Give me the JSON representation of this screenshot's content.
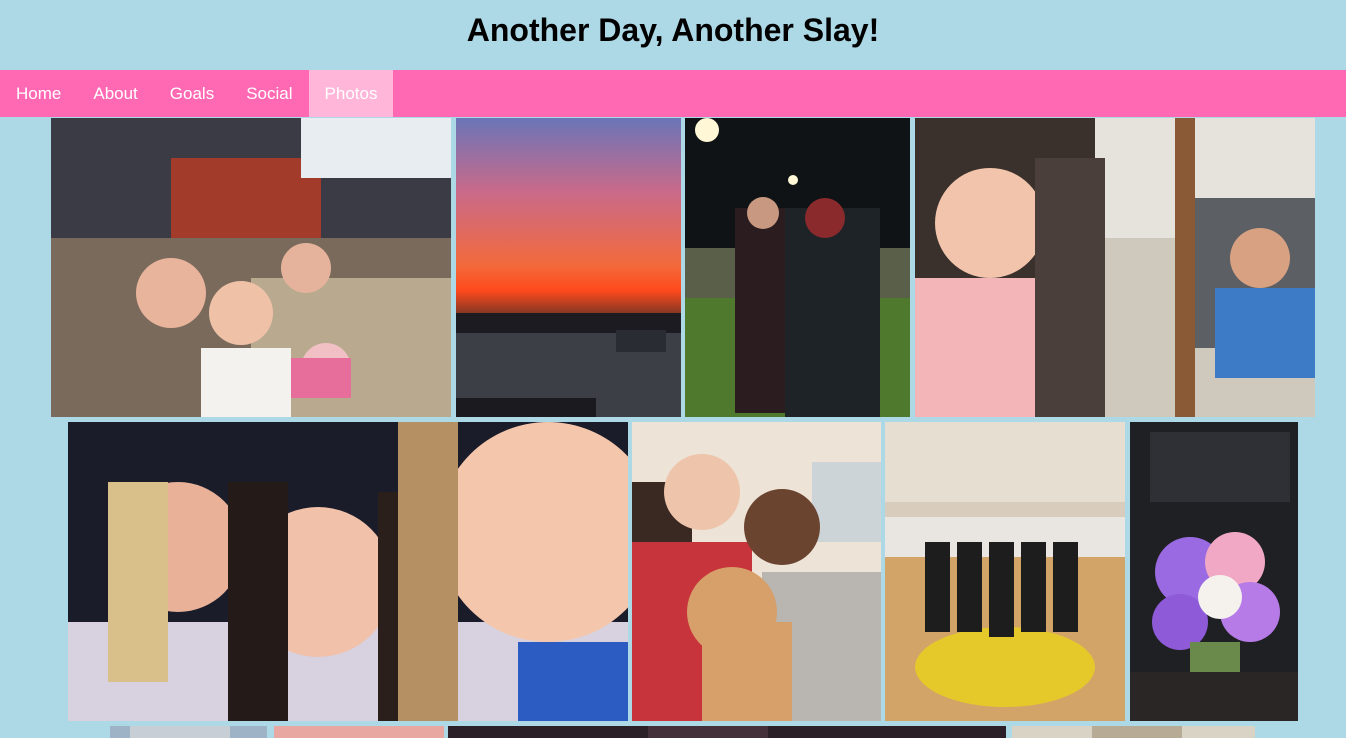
{
  "header": {
    "title": "Another Day, Another Slay!"
  },
  "nav": {
    "items": [
      {
        "label": "Home",
        "active": false
      },
      {
        "label": "About",
        "active": false
      },
      {
        "label": "Goals",
        "active": false
      },
      {
        "label": "Social",
        "active": false
      },
      {
        "label": "Photos",
        "active": true
      }
    ]
  },
  "colors": {
    "page_background": "#add8e6",
    "nav_background": "#ff69b4",
    "nav_active": "#ffb6d9"
  }
}
